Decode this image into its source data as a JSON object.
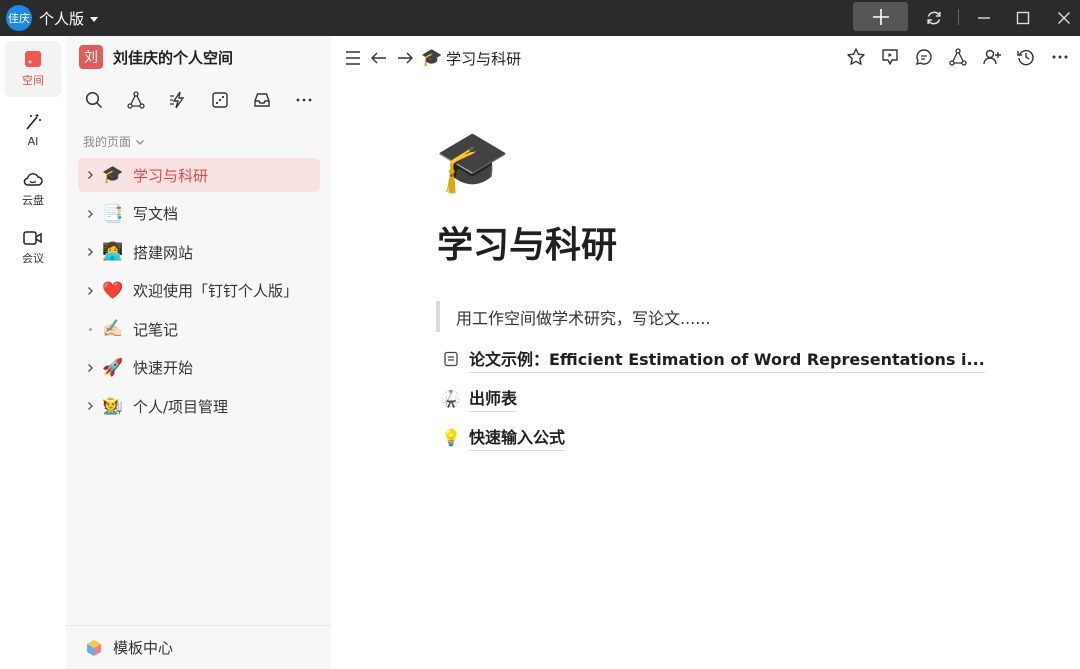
{
  "titlebar": {
    "avatar_text": "佳庆",
    "account_name": "个人版"
  },
  "rail": {
    "items": [
      {
        "label": "空间",
        "icon": "space-icon"
      },
      {
        "label": "AI",
        "icon": "ai-wand-icon"
      },
      {
        "label": "云盘",
        "icon": "cloud-icon"
      },
      {
        "label": "会议",
        "icon": "video-icon"
      }
    ]
  },
  "sidebar": {
    "workspace_avatar": "刘",
    "workspace_title": "刘佳庆的个人空间",
    "section_label": "我的页面",
    "pages": [
      {
        "emoji": "🎓",
        "label": "学习与科研"
      },
      {
        "emoji": "📑",
        "label": "写文档"
      },
      {
        "emoji": "👩‍💻",
        "label": "搭建网站"
      },
      {
        "emoji": "❤️",
        "label": "欢迎使用「钉钉个人版」"
      },
      {
        "emoji": "✍🏻",
        "label": "记笔记"
      },
      {
        "emoji": "🚀",
        "label": "快速开始"
      },
      {
        "emoji": "🧑‍🌾",
        "label": "个人/项目管理"
      }
    ],
    "template_center": "模板中心"
  },
  "main": {
    "breadcrumb_emoji": "🎓",
    "breadcrumb": "学习与科研",
    "page_icon": "🎓",
    "page_title": "学习与科研",
    "quote": "用工作空间做学术研究，写论文......",
    "sub_pages": [
      {
        "icon": "document-icon",
        "emoji": "",
        "title": "论文示例：Efficient Estimation of Word Representations i..."
      },
      {
        "icon": "martial-arts-icon",
        "emoji": "🥋",
        "title": "出师表"
      },
      {
        "icon": "lightbulb-icon",
        "emoji": "💡",
        "title": "快速输入公式"
      }
    ]
  },
  "colors": {
    "accent": "#d84a4a",
    "selected_bg": "#f8e1e1",
    "titlebar_bg": "#2b2b2b",
    "sidebar_bg": "#f7f7f7"
  }
}
